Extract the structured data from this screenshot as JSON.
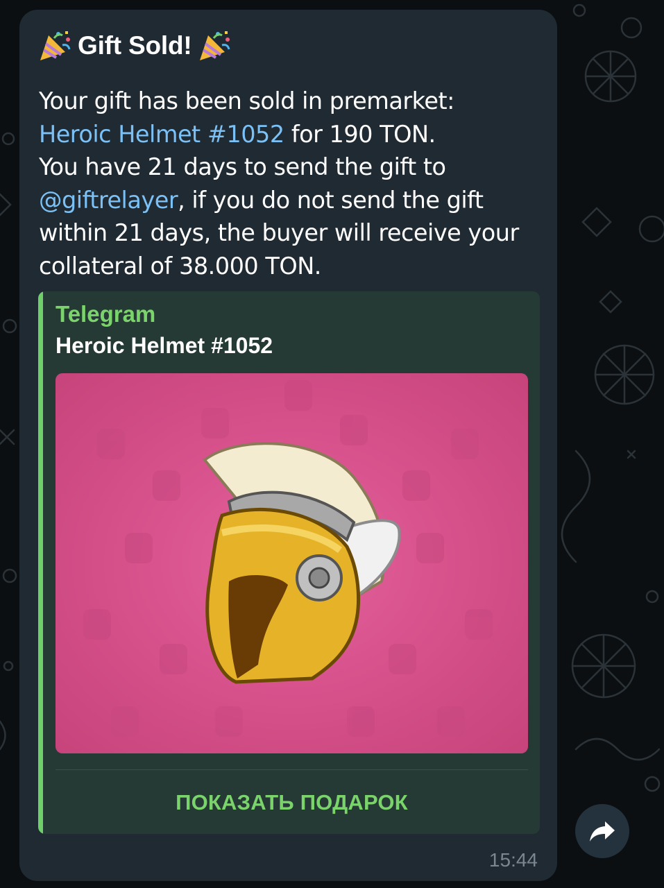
{
  "message": {
    "header_title": "Gift Sold!",
    "body_line_1": "Your gift has been sold in premarket:",
    "gift_link_text": "Heroic Helmet #1052",
    "gift_price_text": " for 190 TON.",
    "body_line_3": "You have 21 days to send the gift to",
    "relayer_mention": "@giftrelayer",
    "body_after_mention": ", if you do not send the gift within 21 days, the buyer will receive your collateral of 38.000 TON.",
    "time": "15:44"
  },
  "link_preview": {
    "site_name": "Telegram",
    "title": "Heroic Helmet #1052",
    "action_label": "ПОКАЗАТЬ ПОДАРОК",
    "image_subject": "heroic-helmet-icon"
  },
  "colors": {
    "bubble": "#1f2a33",
    "link": "#7cc1f5",
    "accent_green": "#7ad36b",
    "preview_bg": "#263a35",
    "image_pink": "#d54f89"
  },
  "icons": {
    "header_left": "party-popper-icon",
    "header_right": "party-popper-icon",
    "share": "share-arrow-icon"
  }
}
